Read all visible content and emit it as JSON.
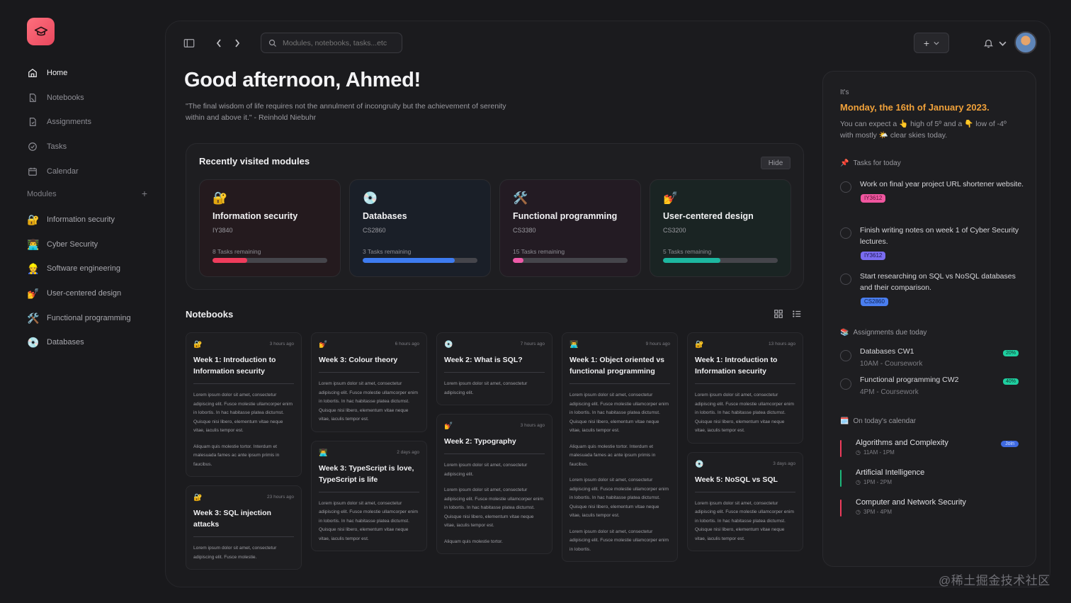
{
  "sidebar": {
    "nav": [
      {
        "label": "Home",
        "icon": "home-icon"
      },
      {
        "label": "Notebooks",
        "icon": "notebook-icon"
      },
      {
        "label": "Assignments",
        "icon": "assignment-icon"
      },
      {
        "label": "Tasks",
        "icon": "check-circle-icon"
      },
      {
        "label": "Calendar",
        "icon": "calendar-icon"
      }
    ],
    "modules_heading": "Modules",
    "modules": [
      {
        "label": "Information security",
        "emoji": "🔐"
      },
      {
        "label": "Cyber Security",
        "emoji": "👨‍💻"
      },
      {
        "label": "Software engineering",
        "emoji": "👷"
      },
      {
        "label": "User-centered design",
        "emoji": "💅"
      },
      {
        "label": "Functional programming",
        "emoji": "🛠️"
      },
      {
        "label": "Databases",
        "emoji": "💿"
      }
    ]
  },
  "topbar": {
    "search_placeholder": "Modules, notebooks, tasks...etc"
  },
  "greeting": "Good afternoon, Ahmed!",
  "quote": "\"The final wisdom of life requires not the annulment of incongruity but the achievement of serenity within and above it.\" - Reinhold Niebuhr",
  "recent": {
    "title": "Recently visited modules",
    "hide_label": "Hide",
    "modules": [
      {
        "emoji": "🔐",
        "name": "Information security",
        "code": "IY3840",
        "remaining": "8 Tasks remaining",
        "progress": 0.3,
        "color": "#ef3c5c",
        "bg": "#241a1e"
      },
      {
        "emoji": "💿",
        "name": "Databases",
        "code": "CS2860",
        "remaining": "3 Tasks remaining",
        "progress": 0.8,
        "color": "#3d7bf0",
        "bg": "#1a1f28"
      },
      {
        "emoji": "🛠️",
        "name": "Functional programming",
        "code": "CS3380",
        "remaining": "15 Tasks remaining",
        "progress": 0.09,
        "color": "#ee5aa8",
        "bg": "#231b23"
      },
      {
        "emoji": "💅",
        "name": "User-centered design",
        "code": "CS3200",
        "remaining": "5 Tasks remaining",
        "progress": 0.5,
        "color": "#1db7a0",
        "bg": "#1a2423"
      }
    ]
  },
  "notebooks": {
    "title": "Notebooks",
    "columns": [
      [
        {
          "emoji": "🔐",
          "ago": "3 hours ago",
          "title": "Week 1: Introduction to Information security",
          "body": [
            "Lorem ipsum dolor sit amet, consectetur adipiscing elit. Fusce molestie ullamcorper enim in lobortis. In hac habitasse platea dictumst. Quisque nisi libero, elementum vitae neque vitae, iaculis tempor est.",
            "Aliquam quis molestie tortor. Interdum et malesuada fames ac ante ipsum primis in faucibus."
          ]
        },
        {
          "emoji": "🔐",
          "ago": "23 hours ago",
          "title": "Week 3: SQL injection attacks",
          "body": [
            "Lorem ipsum dolor sit amet, consectetur adipiscing elit. Fusce molestie."
          ]
        }
      ],
      [
        {
          "emoji": "💅",
          "ago": "6 hours ago",
          "title": "Week 3: Colour theory",
          "body": [
            "Lorem ipsum dolor sit amet, consectetur adipiscing elit. Fusce molestie ullamcorper enim in lobortis. In hac habitasse platea dictumst. Quisque nisi libero, elementum vitae neque vitae, iaculis tempor est."
          ]
        },
        {
          "emoji": "👨‍💻",
          "ago": "2 days ago",
          "title": "Week 3: TypeScript is love, TypeScript is life",
          "body": [
            "Lorem ipsum dolor sit amet, consectetur adipiscing elit. Fusce molestie ullamcorper enim in lobortis. In hac habitasse platea dictumst. Quisque nisi libero, elementum vitae neque vitae, iaculis tempor est."
          ]
        }
      ],
      [
        {
          "emoji": "💿",
          "ago": "7 hours ago",
          "title": "Week 2: What is SQL?",
          "body": [
            "Lorem ipsum dolor sit amet, consectetur adipiscing elit."
          ]
        },
        {
          "emoji": "💅",
          "ago": "3 hours ago",
          "title": "Week 2: Typography",
          "body": [
            "Lorem ipsum dolor sit amet, consectetur adipiscing elit.",
            "Lorem ipsum dolor sit amet, consectetur adipiscing elit. Fusce molestie ullamcorper enim in lobortis. In hac habitasse platea dictumst. Quisque nisi libero, elementum vitae neque vitae, iaculis tempor est.",
            "Aliquam quis molestie tortor."
          ]
        }
      ],
      [
        {
          "emoji": "👨‍💻",
          "ago": "9 hours ago",
          "title": "Week 1: Object oriented vs functional programming",
          "body": [
            "Lorem ipsum dolor sit amet, consectetur adipiscing elit. Fusce molestie ullamcorper enim in lobortis. In hac habitasse platea dictumst. Quisque nisi libero, elementum vitae neque vitae, iaculis tempor est.",
            "Aliquam quis molestie tortor. Interdum et malesuada fames ac ante ipsum primis in faucibus.",
            "Lorem ipsum dolor sit amet, consectetur adipiscing elit. Fusce molestie ullamcorper enim in lobortis. In hac habitasse platea dictumst. Quisque nisi libero, elementum vitae neque vitae, iaculis tempor est.",
            "Lorem ipsum dolor sit amet, consectetur adipiscing elit. Fusce molestie ullamcorper enim in lobortis."
          ]
        }
      ],
      [
        {
          "emoji": "🔐",
          "ago": "13 hours ago",
          "title": "Week 1: Introduction to Information security",
          "body": [
            "Lorem ipsum dolor sit amet, consectetur adipiscing elit. Fusce molestie ullamcorper enim in lobortis. In hac habitasse platea dictumst. Quisque nisi libero, elementum vitae neque vitae, iaculis tempor est."
          ]
        },
        {
          "emoji": "💿",
          "ago": "3 days ago",
          "title": "Week 5: NoSQL vs SQL",
          "body": [
            "Lorem ipsum dolor sit amet, consectetur adipiscing elit. Fusce molestie ullamcorper enim in lobortis. In hac habitasse platea dictumst. Quisque nisi libero, elementum vitae neque vitae, iaculis tempor est."
          ]
        }
      ]
    ]
  },
  "today": {
    "its": "It's",
    "date": "Monday, the 16th of January 2023.",
    "weather": "You can expect a 👆 high of 5º and a 👇 low of -4º with mostly 🌤️ clear skies today.",
    "tasks_heading": "Tasks for today",
    "tasks_icon": "📌",
    "tasks": [
      {
        "text": "Work on final year project URL shortener website.",
        "tag": "IY3612",
        "tag_bg": "#f0569f",
        "tag_fg": "#5c1238"
      },
      {
        "text": "Finish writing notes on week 1 of Cyber Security lectures.",
        "tag": "IY3612",
        "tag_bg": "#7a6cf0",
        "tag_fg": "#1f1850"
      },
      {
        "text": "Start researching on SQL vs NoSQL databases and their comparison.",
        "tag": "CS2860",
        "tag_bg": "#4a7ef0",
        "tag_fg": "#0f2250"
      }
    ],
    "assignments_heading": "Assignments due today",
    "assignments_icon": "📚",
    "assignments": [
      {
        "title": "Databases CW1",
        "sub": "10AM - Coursework",
        "pct": "20%"
      },
      {
        "title": "Functional programming CW2",
        "sub": "4PM - Coursework",
        "pct": "40%"
      }
    ],
    "calendar_heading": "On today's calendar",
    "calendar_icon": "🗓️",
    "events": [
      {
        "title": "Algorithms and Complexity",
        "time": "11AM - 1PM",
        "color": "#ef3c5c",
        "join": "Join"
      },
      {
        "title": "Artificial Intelligence",
        "time": "1PM - 2PM",
        "color": "#1db77a",
        "join": ""
      },
      {
        "title": "Computer and Network Security",
        "time": "3PM - 4PM",
        "color": "#ef3c5c",
        "join": ""
      }
    ]
  },
  "watermark": "@稀土掘金技术社区"
}
